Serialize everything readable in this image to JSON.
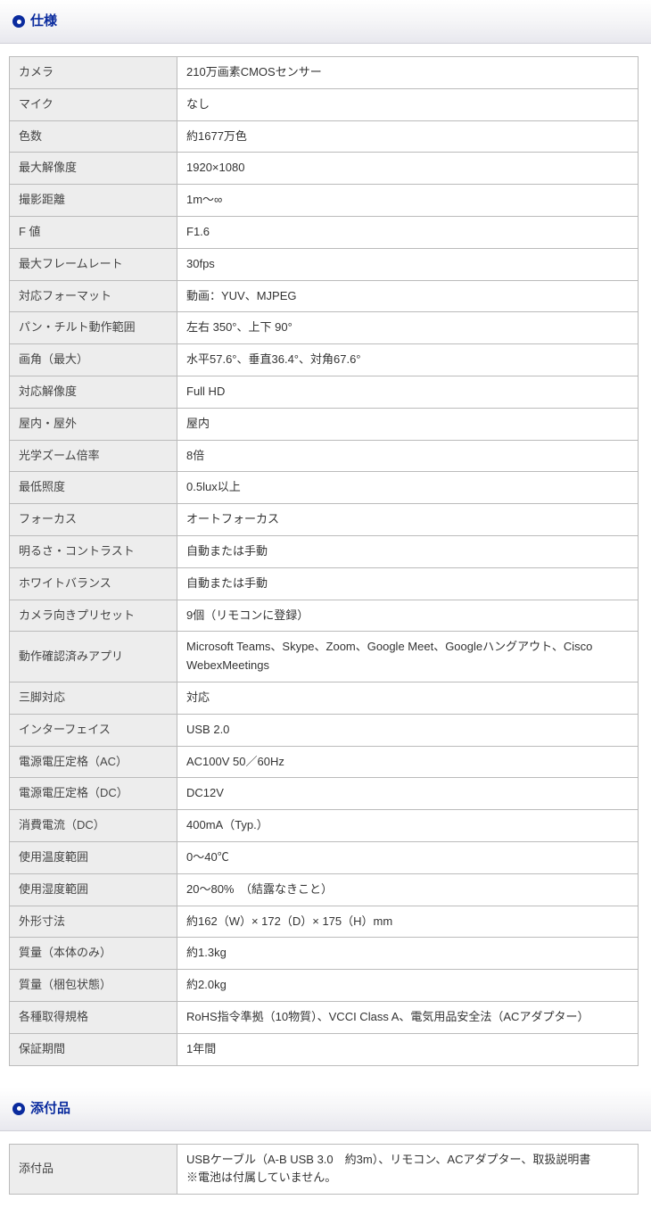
{
  "sections": {
    "spec": {
      "title": "仕様"
    },
    "accessory": {
      "title": "添付品"
    }
  },
  "spec_rows": [
    {
      "label": "カメラ",
      "value": "210万画素CMOSセンサー"
    },
    {
      "label": "マイク",
      "value": "なし"
    },
    {
      "label": "色数",
      "value": "約1677万色"
    },
    {
      "label": "最大解像度",
      "value": "1920×1080"
    },
    {
      "label": "撮影距離",
      "value": "1m～∞"
    },
    {
      "label": "F 値",
      "value": "F1.6"
    },
    {
      "label": "最大フレームレート",
      "value": "30fps"
    },
    {
      "label": "対応フォーマット",
      "value": "動画：YUV、MJPEG"
    },
    {
      "label": "パン・チルト動作範囲",
      "value": "左右 350°、上下 90°"
    },
    {
      "label": "画角（最大）",
      "value": "水平57.6°、垂直36.4°、対角67.6°"
    },
    {
      "label": "対応解像度",
      "value": "Full HD"
    },
    {
      "label": "屋内・屋外",
      "value": "屋内"
    },
    {
      "label": "光学ズーム倍率",
      "value": "8倍"
    },
    {
      "label": "最低照度",
      "value": "0.5lux以上"
    },
    {
      "label": "フォーカス",
      "value": "オートフォーカス"
    },
    {
      "label": "明るさ・コントラスト",
      "value": "自動または手動"
    },
    {
      "label": "ホワイトバランス",
      "value": "自動または手動"
    },
    {
      "label": "カメラ向きプリセット",
      "value": "9個（リモコンに登録）"
    },
    {
      "label": "動作確認済みアプリ",
      "value": "Microsoft Teams、Skype、Zoom、Google Meet、Googleハングアウト、Cisco WebexMeetings"
    },
    {
      "label": "三脚対応",
      "value": "対応"
    },
    {
      "label": "インターフェイス",
      "value": "USB 2.0"
    },
    {
      "label": "電源電圧定格（AC）",
      "value": "AC100V 50／60Hz"
    },
    {
      "label": "電源電圧定格（DC）",
      "value": "DC12V"
    },
    {
      "label": "消費電流（DC）",
      "value": "400mA（Typ.）"
    },
    {
      "label": "使用温度範囲",
      "value": "0～40℃"
    },
    {
      "label": "使用湿度範囲",
      "value": "20～80%　（結露なきこと）"
    },
    {
      "label": "外形寸法",
      "value": "約162（W）× 172（D）× 175（H）mm"
    },
    {
      "label": "質量（本体のみ）",
      "value": "約1.3kg"
    },
    {
      "label": "質量（梱包状態）",
      "value": "約2.0kg"
    },
    {
      "label": "各種取得規格",
      "value": "RoHS指令準拠（10物質）、VCCI Class A、電気用品安全法（ACアダプター）"
    },
    {
      "label": "保証期間",
      "value": "1年間"
    }
  ],
  "accessory_rows": [
    {
      "label": "添付品",
      "value": "USBケーブル（A-B USB 3.0　約3m）、リモコン、ACアダプター、取扱説明書\n※電池は付属していません。"
    }
  ]
}
